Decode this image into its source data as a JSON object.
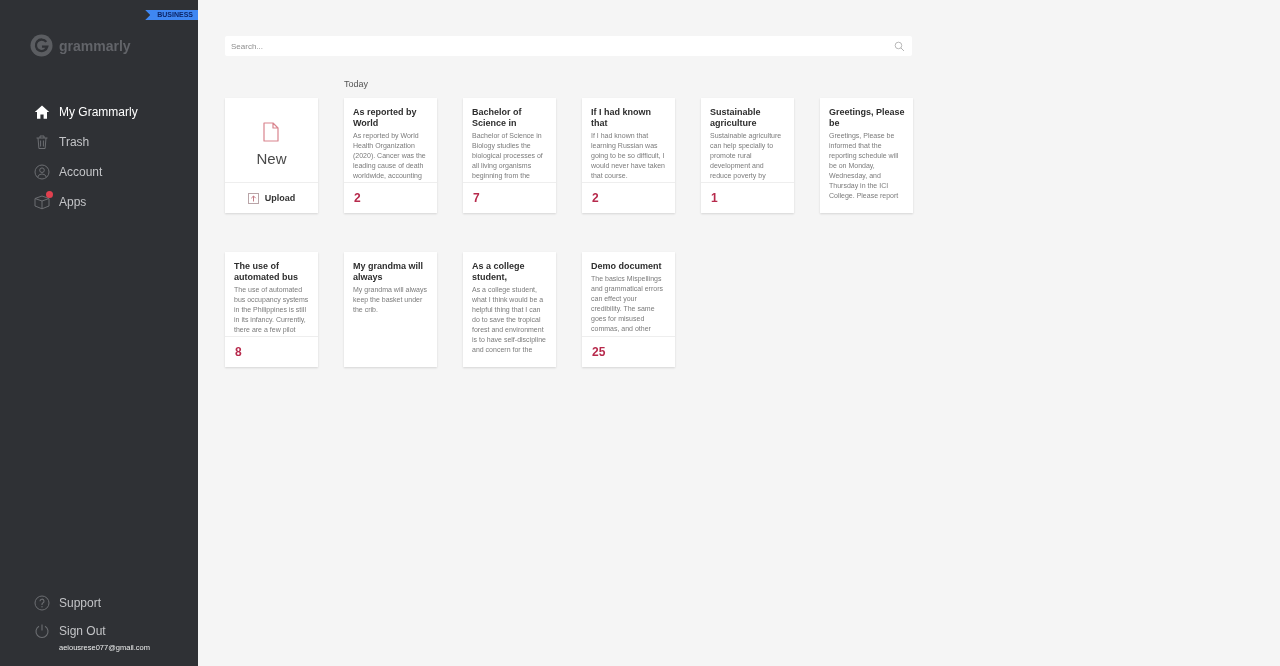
{
  "sidebar": {
    "badge": "BUSINESS",
    "logo": "grammarly",
    "items": [
      {
        "label": "My Grammarly",
        "selected": true,
        "notification": false
      },
      {
        "label": "Trash",
        "selected": false,
        "notification": false
      },
      {
        "label": "Account",
        "selected": false,
        "notification": false
      },
      {
        "label": "Apps",
        "selected": false,
        "notification": true
      }
    ],
    "bottom_items": [
      {
        "label": "Support"
      },
      {
        "label": "Sign Out"
      }
    ],
    "account_email": "aeiousrese077@gmail.com"
  },
  "search": {
    "placeholder": "Search..."
  },
  "section_label": "Today",
  "new_card": {
    "label": "New",
    "upload": "Upload"
  },
  "documents": [
    {
      "title": "As reported by World",
      "excerpt": "As reported by World Health Organization (2020). Cancer was the leading cause of death worldwide, accounting",
      "issues": "2"
    },
    {
      "title": "Bachelor of Science in",
      "excerpt": "Bachelor of Science in Biology studies the biological processes of all living organisms beginning from the",
      "issues": "7"
    },
    {
      "title": "If I had known that",
      "excerpt": "If I had known that learning Russian was going to be so difficult, I would never have taken that course.",
      "issues": "2"
    },
    {
      "title": "Sustainable agriculture",
      "excerpt": "Sustainable agriculture can help specially to promote rural development and reduce poverty by",
      "issues": "1"
    },
    {
      "title": "Greetings, Please be",
      "excerpt": "Greetings, Please be informed that the reporting schedule will be on Monday, Wednesday, and Thursday in the ICI College. Please report"
    },
    {
      "title": "The use of automated bus",
      "excerpt": "The use of automated bus occupancy systems in the Philippines is still in its infancy. Currently, there are a few pilot",
      "issues": "8"
    },
    {
      "title": "My grandma will always",
      "excerpt": "My grandma will always keep the basket under the crib."
    },
    {
      "title": "As a college student,",
      "excerpt": "As a college student, what I think would be a helpful thing that I can do to save the tropical forest and environment is to have self-discipline and concern for the"
    },
    {
      "title": "Demo document",
      "excerpt": "The basics Mispellings and grammatical errors can effect your credibility. The same goes for misused commas, and other",
      "issues": "25"
    }
  ]
}
